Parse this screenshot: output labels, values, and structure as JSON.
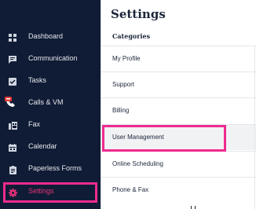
{
  "sidebar": {
    "items": [
      {
        "label": "Dashboard",
        "icon": "dashboard-icon"
      },
      {
        "label": "Communication",
        "icon": "chat-icon"
      },
      {
        "label": "Tasks",
        "icon": "checkbox-icon"
      },
      {
        "label": "Calls & VM",
        "icon": "phone-icon",
        "badge_color": "#e53935"
      },
      {
        "label": "Fax",
        "icon": "fax-icon"
      },
      {
        "label": "Calendar",
        "icon": "calendar-icon"
      },
      {
        "label": "Paperless Forms",
        "icon": "clipboard-icon"
      },
      {
        "label": "Settings",
        "icon": "gear-icon",
        "active": true
      }
    ],
    "background": "#101c35",
    "active_color": "#e9327a"
  },
  "main": {
    "title": "Settings",
    "categories_heading": "Categories",
    "categories": [
      {
        "label": "My Profile"
      },
      {
        "label": "Support"
      },
      {
        "label": "Billing"
      },
      {
        "label": "User Management",
        "hovered": true
      },
      {
        "label": "Online Scheduling"
      },
      {
        "label": "Phone & Fax"
      }
    ]
  },
  "highlight_color": "#ee2b8f"
}
